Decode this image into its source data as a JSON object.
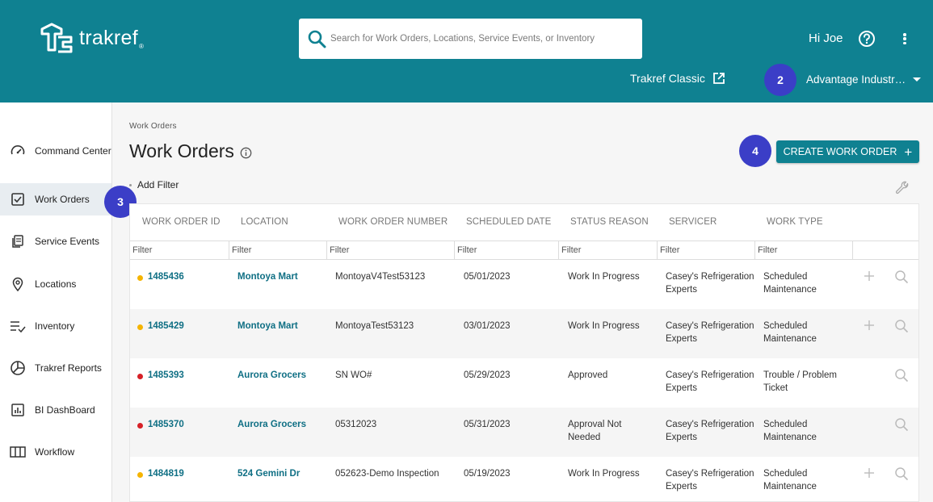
{
  "header": {
    "brand": "trakref",
    "search_placeholder": "Search for Work Orders, Locations, Service Events, or Inventory",
    "greeting": "Hi Joe",
    "classic_link": "Trakref Classic",
    "account": "Advantage Industr…"
  },
  "badges": {
    "b2": "2",
    "b3": "3",
    "b4": "4"
  },
  "sidebar": {
    "items": [
      {
        "label": "Command Center",
        "icon": "gauge-icon"
      },
      {
        "label": "Work Orders",
        "icon": "checklist-icon"
      },
      {
        "label": "Service Events",
        "icon": "copy-icon"
      },
      {
        "label": "Locations",
        "icon": "map-pin-icon"
      },
      {
        "label": "Inventory",
        "icon": "list-check-icon"
      },
      {
        "label": "Trakref Reports",
        "icon": "pie-chart-icon"
      },
      {
        "label": "BI DashBoard",
        "icon": "bar-chart-icon"
      },
      {
        "label": "Workflow",
        "icon": "columns-icon"
      }
    ]
  },
  "main": {
    "breadcrumb": "Work Orders",
    "title": "Work Orders",
    "create_button": "CREATE WORK ORDER",
    "add_filter": "Add Filter"
  },
  "table": {
    "columns": [
      "WORK ORDER ID",
      "LOCATION",
      "WORK ORDER NUMBER",
      "SCHEDULED DATE",
      "STATUS REASON",
      "SERVICER",
      "WORK TYPE"
    ],
    "filter_placeholder": "Filter",
    "rows": [
      {
        "id": "1485436",
        "location": "Montoya Mart",
        "number": "MontoyaV4Test53123",
        "date": "05/01/2023",
        "status_l1": "Work In Progress",
        "status_l2": "",
        "servicer_l1": "Casey's Refrigeration",
        "servicer_l2": "Experts",
        "type_l1": "Scheduled",
        "type_l2": "Maintenance",
        "dot_color": "#f5b400",
        "has_plus": true
      },
      {
        "id": "1485429",
        "location": "Montoya Mart",
        "number": "MontoyaTest53123",
        "date": "03/01/2023",
        "status_l1": "Work In Progress",
        "status_l2": "",
        "servicer_l1": "Casey's Refrigeration",
        "servicer_l2": "Experts",
        "type_l1": "Scheduled",
        "type_l2": "Maintenance",
        "dot_color": "#f5b400",
        "has_plus": true
      },
      {
        "id": "1485393",
        "location": "Aurora Grocers",
        "number": "SN WO#",
        "date": "05/29/2023",
        "status_l1": "Approved",
        "status_l2": "",
        "servicer_l1": "Casey's Refrigeration",
        "servicer_l2": "Experts",
        "type_l1": "Trouble / Problem",
        "type_l2": "Ticket",
        "dot_color": "#d62027",
        "has_plus": false
      },
      {
        "id": "1485370",
        "location": "Aurora Grocers",
        "number": "05312023",
        "date": "05/31/2023",
        "status_l1": "Approval Not",
        "status_l2": "Needed",
        "servicer_l1": "Casey's Refrigeration",
        "servicer_l2": "Experts",
        "type_l1": "Scheduled",
        "type_l2": "Maintenance",
        "dot_color": "#d62027",
        "has_plus": false
      },
      {
        "id": "1484819",
        "location": "524 Gemini Dr",
        "number": "052623-Demo Inspection",
        "date": "05/19/2023",
        "status_l1": "Work In Progress",
        "status_l2": "",
        "servicer_l1": "Casey's Refrigeration",
        "servicer_l2": "Experts",
        "type_l1": "Scheduled",
        "type_l2": "Maintenance",
        "dot_color": "#f5b400",
        "has_plus": true
      }
    ]
  },
  "colors": {
    "brand_teal": "#0f8191",
    "badge_blue": "#3b3ec7",
    "link": "#0f6f84",
    "status_yellow": "#f5b400",
    "status_red": "#d62027"
  }
}
